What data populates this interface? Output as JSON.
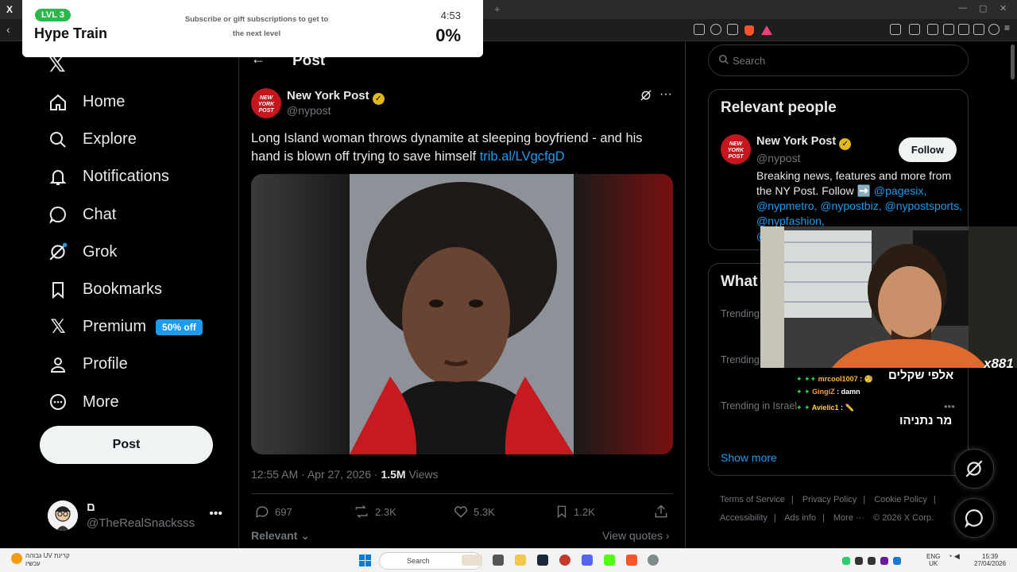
{
  "hype_train": {
    "level": "LVL 3",
    "title": "Hype Train",
    "subtitle": "Subscribe or gift subscriptions to get to the next level",
    "time": "4:53",
    "percent": "0%"
  },
  "nav": {
    "items": [
      {
        "label": "Home",
        "icon": "home-icon"
      },
      {
        "label": "Explore",
        "icon": "search-icon"
      },
      {
        "label": "Notifications",
        "icon": "bell-icon"
      },
      {
        "label": "Chat",
        "icon": "chat-icon"
      },
      {
        "label": "Grok",
        "icon": "grok-icon"
      },
      {
        "label": "Bookmarks",
        "icon": "bookmark-icon"
      },
      {
        "label": "Premium",
        "icon": "x-icon",
        "badge": "50% off"
      },
      {
        "label": "Profile",
        "icon": "person-icon"
      },
      {
        "label": "More",
        "icon": "more-circle-icon"
      }
    ],
    "post_button": "Post"
  },
  "account": {
    "name": "ם",
    "handle": "@TheRealSnacksss"
  },
  "header": {
    "title": "Post"
  },
  "tweet": {
    "author_name": "New York Post",
    "author_handle": "@nypost",
    "avatar_text": "NEW YORK POST",
    "text": "Long Island woman throws dynamite at sleeping boyfriend - and his hand is blown off trying to save himself ",
    "link": "trib.al/LVgcfgD",
    "time": "12:55 AM · Apr 27, 2026 · ",
    "views_count": "1.5M",
    "views_label": " Views",
    "replies": "697",
    "reposts": "2.3K",
    "likes": "5.3K",
    "bookmarks": "1.2K",
    "sort_label": "Relevant",
    "view_quotes": "View quotes ›"
  },
  "search": {
    "placeholder": "Search"
  },
  "relevant_people": {
    "title": "Relevant people",
    "name": "New York Post",
    "handle": "@nypost",
    "follow": "Follow",
    "bio_text": "Breaking news, features and more from the NY Post. Follow ➡️ ",
    "bio_links": "@pagesix, @nypmetro, @nypostbiz, @nypostsports, @nypfashion,",
    "bio_cut": "@"
  },
  "whats_happening": {
    "title": "What",
    "trends": [
      "Trending",
      "Trending",
      "Trending in Israel"
    ],
    "show_more": "Show more"
  },
  "footer": {
    "links": [
      "Terms of Service",
      "|",
      "Privacy Policy",
      "|",
      "Cookie Policy",
      "|",
      "Accessibility",
      "|",
      "Ads info",
      "|",
      "More ···",
      "© 2026 X Corp."
    ]
  },
  "stream_overlay": {
    "viewer_count": "x881",
    "chat": [
      {
        "user": "mrcool1007",
        "msg": "🧐"
      },
      {
        "user": "GingiZ",
        "msg": "damn"
      },
      {
        "user": "Avielic1",
        "msg": "✏️"
      }
    ],
    "hebrew_1": "אלפי שקלים",
    "hebrew_2": "מר נתניהו"
  },
  "taskbar": {
    "weather_line1": "קרינת UV גבוהה",
    "weather_line2": "עכשיו",
    "search": "Search",
    "lang_1": "ENG",
    "lang_2": "UK",
    "clock_time": "15:39",
    "clock_date": "27/04/2026"
  },
  "colors": {
    "accent": "#1d9bf0",
    "hype_green": "#2bb74a",
    "nypost_red": "#c4161c",
    "verified_gold": "#e2b719"
  }
}
